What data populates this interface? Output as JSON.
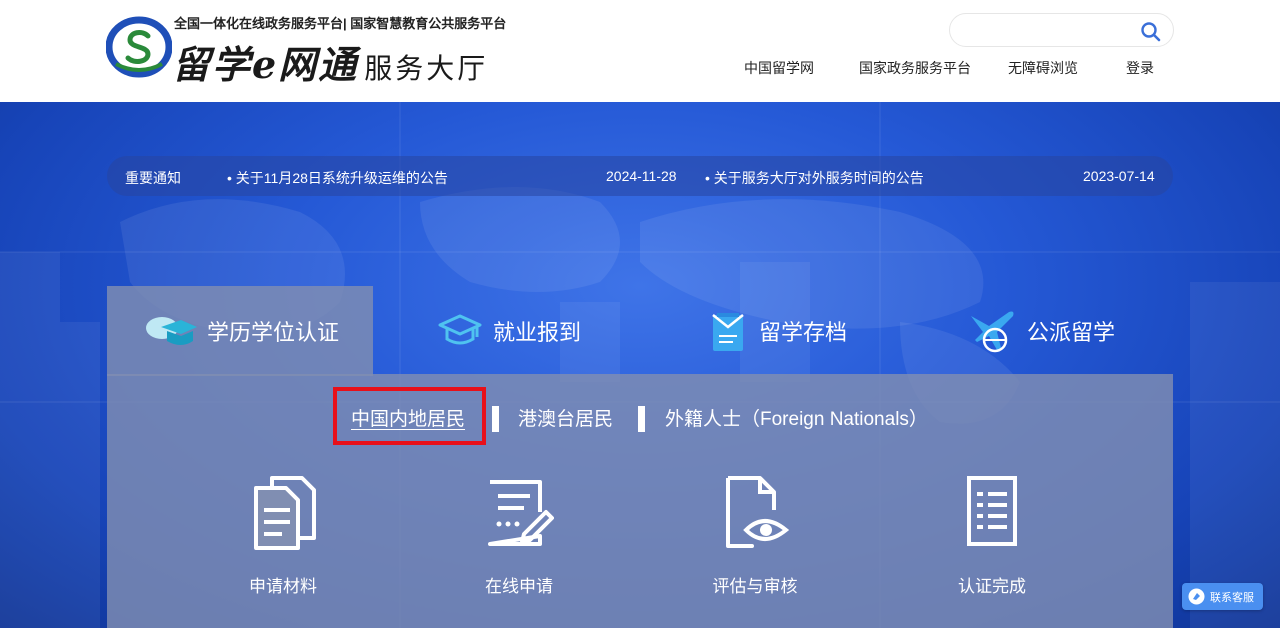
{
  "header": {
    "logo_sub": "全国一体化在线政务服务平台| 国家智慧教育公共服务平台",
    "logo_brand": "留学e网通",
    "logo_hall": "服务大厅",
    "search": {
      "placeholder": "",
      "value": ""
    },
    "nav": [
      "中国留学网",
      "国家政务服务平台",
      "无障碍浏览",
      "登录"
    ]
  },
  "notices": {
    "label": "重要通知",
    "items": [
      {
        "title": "• 关于11月28日系统升级运维的公告",
        "date": "2024-11-28"
      },
      {
        "title": "• 关于服务大厅对外服务时间的公告",
        "date": "2023-07-14"
      }
    ]
  },
  "service_tabs": [
    {
      "label": "学历学位认证",
      "active": true
    },
    {
      "label": "就业报到",
      "active": false
    },
    {
      "label": "留学存档",
      "active": false
    },
    {
      "label": "公派留学",
      "active": false
    }
  ],
  "subtabs": [
    {
      "label": "中国内地居民",
      "active": true
    },
    {
      "label": "港澳台居民",
      "active": false
    },
    {
      "label": "外籍人士（Foreign Nationals）",
      "active": false
    }
  ],
  "steps": [
    "申请材料",
    "在线申请",
    "评估与审核",
    "认证完成"
  ],
  "service_button": {
    "label": "联系客服"
  },
  "colors": {
    "hero_blue": "#2559d6",
    "panel": "#808eb2",
    "highlight_red": "#e8101a",
    "search_icon": "#3a6fd8",
    "service_button": "#4a8ff0"
  }
}
